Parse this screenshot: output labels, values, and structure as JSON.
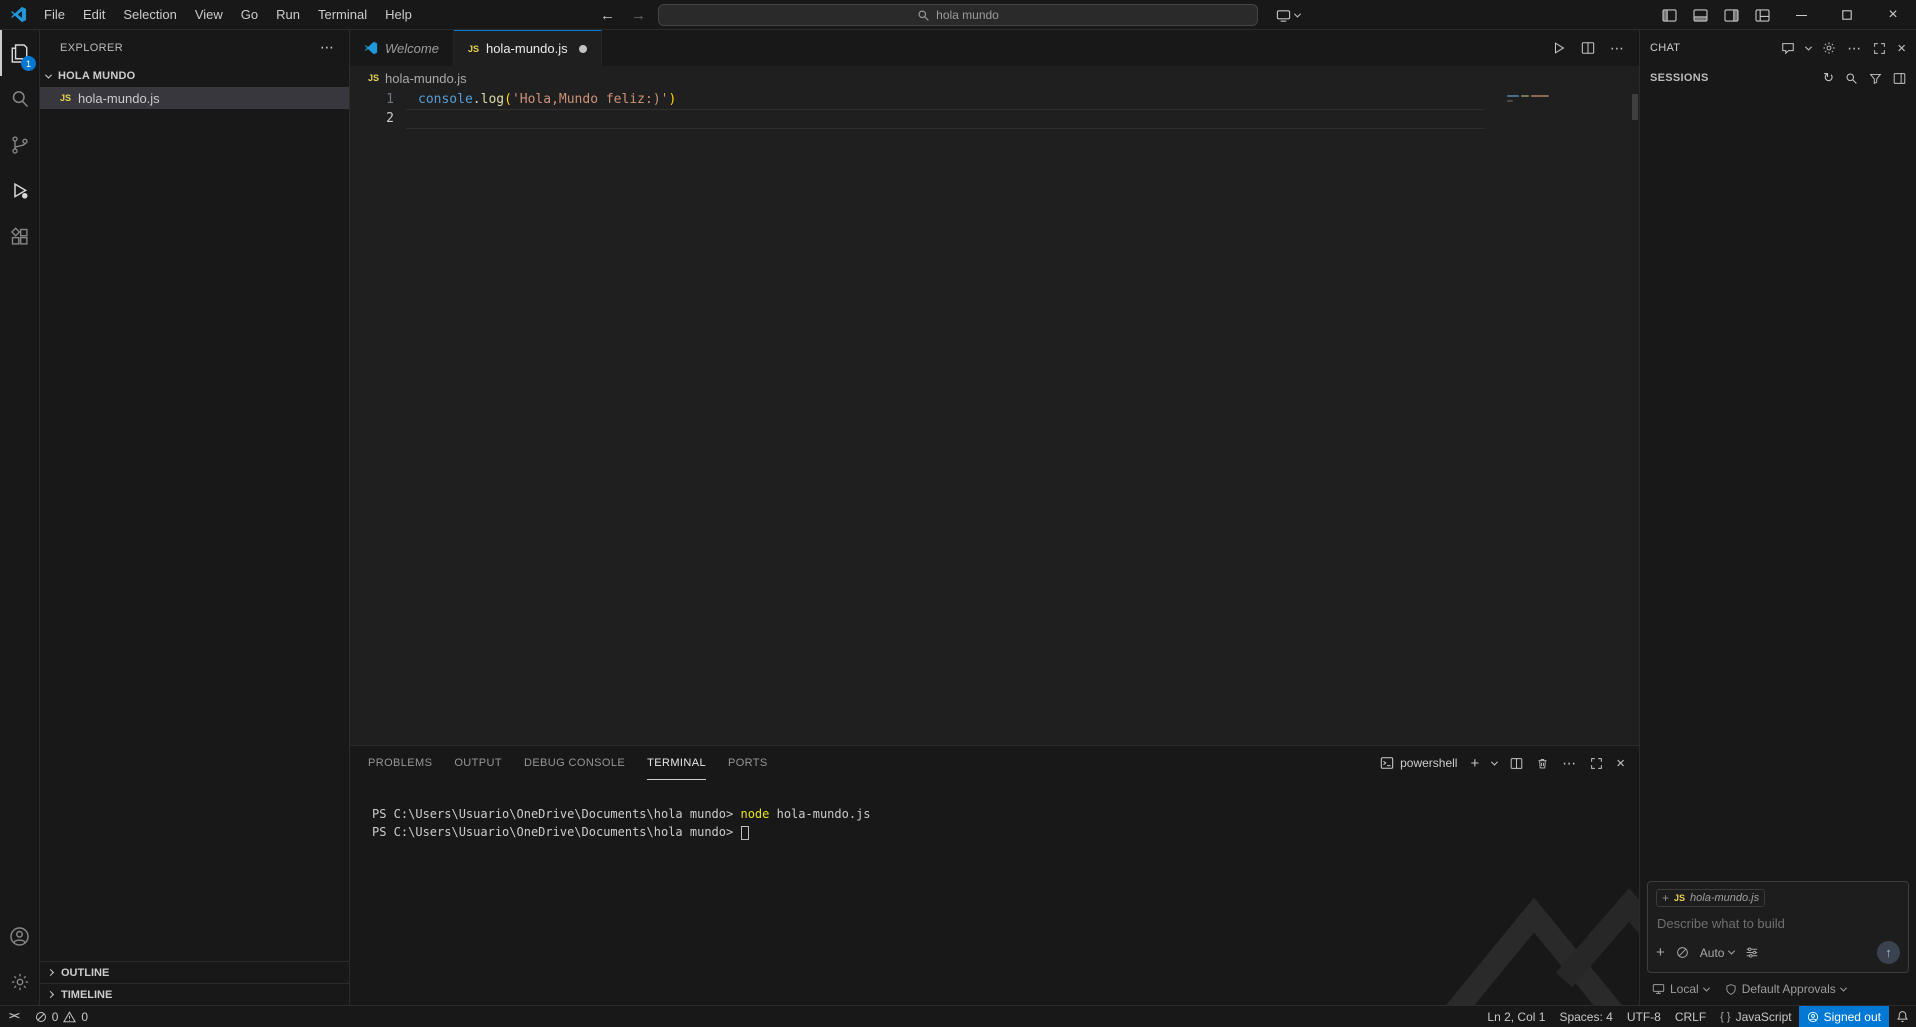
{
  "colors": {
    "accent_blue": "#0078d4",
    "js_icon_yellow": "#e8d44d",
    "code_object_blue": "#569cd6",
    "code_method_yellow": "#dcdcaa",
    "code_string_orange": "#ce9178",
    "bracket_gold": "#ffd602",
    "terminal_command_yellow": "#e5e510",
    "signed_out_bg": "#0078d4"
  },
  "icons": {
    "js": "JS"
  },
  "title_bar": {
    "menus": [
      "File",
      "Edit",
      "Selection",
      "View",
      "Go",
      "Run",
      "Terminal",
      "Help"
    ],
    "search_text": "hola mundo"
  },
  "activity_bar": {
    "explorer_badge": "1"
  },
  "sidebar": {
    "title": "EXPLORER",
    "folder": "HOLA MUNDO",
    "file": "hola-mundo.js",
    "outline": "OUTLINE",
    "timeline": "TIMELINE"
  },
  "editor": {
    "tabs": [
      {
        "label": "Welcome"
      },
      {
        "label": "hola-mundo.js"
      }
    ],
    "breadcrumb": "hola-mundo.js",
    "lines": [
      {
        "num": "1"
      },
      {
        "num": "2"
      }
    ],
    "tokens": {
      "obj": "console",
      "dot": ".",
      "method": "log",
      "open": "(",
      "string": "'Hola,Mundo feliz:)'",
      "close": ")"
    }
  },
  "panel": {
    "tabs": [
      "PROBLEMS",
      "OUTPUT",
      "DEBUG CONSOLE",
      "TERMINAL",
      "PORTS"
    ],
    "shell": "powershell",
    "terminal": {
      "prompt": "PS C:\\Users\\Usuario\\OneDrive\\Documents\\hola mundo>",
      "command": "node",
      "arg": "hola-mundo.js"
    }
  },
  "chat": {
    "title": "CHAT",
    "sessions": "SESSIONS",
    "chip_file": "hola-mundo.js",
    "placeholder": "Describe what to build",
    "mode": "Auto",
    "local": "Local",
    "approvals": "Default Approvals"
  },
  "status_bar": {
    "errors": "0",
    "warnings": "0",
    "ln_col": "Ln 2, Col 1",
    "spaces": "Spaces: 4",
    "encoding": "UTF-8",
    "eol": "CRLF",
    "braces": "{ }",
    "language": "JavaScript",
    "account": "Signed out"
  }
}
